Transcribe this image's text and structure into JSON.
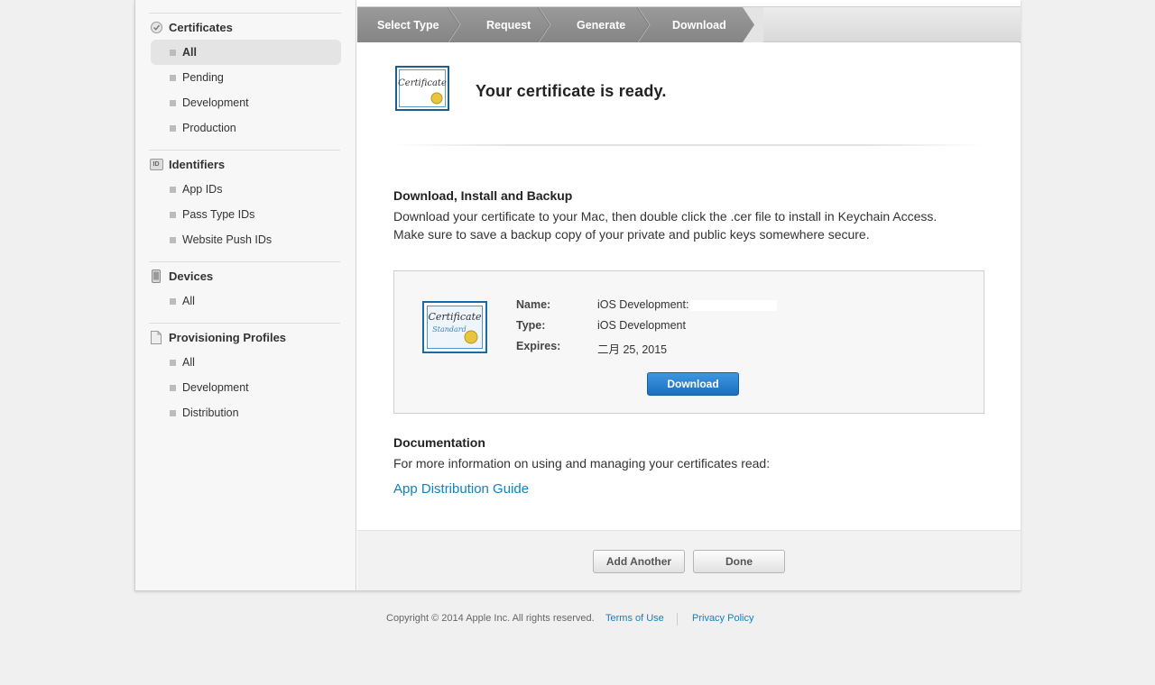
{
  "sidebar": {
    "sections": [
      {
        "title": "Certificates",
        "icon": "certificate-seal-icon",
        "items": [
          "All",
          "Pending",
          "Development",
          "Production"
        ],
        "active": "All"
      },
      {
        "title": "Identifiers",
        "icon": "id-badge-icon",
        "icon_text": "ID",
        "items": [
          "App IDs",
          "Pass Type IDs",
          "Website Push IDs"
        ]
      },
      {
        "title": "Devices",
        "icon": "iphone-icon",
        "items": [
          "All"
        ]
      },
      {
        "title": "Provisioning Profiles",
        "icon": "document-icon",
        "items": [
          "All",
          "Development",
          "Distribution"
        ]
      }
    ]
  },
  "steps": [
    "Select Type",
    "Request",
    "Generate",
    "Download"
  ],
  "current_step": "Download",
  "hero": {
    "title": "Your certificate is ready."
  },
  "download_section": {
    "heading": "Download, Install and Backup",
    "text": "Download your certificate to your Mac, then double click the .cer file to install in Keychain Access. Make sure to save a backup copy of your private and public keys somewhere secure."
  },
  "certificate": {
    "name_label": "Name:",
    "name_value": "iOS Development:",
    "type_label": "Type:",
    "type_value": "iOS Development",
    "expires_label": "Expires:",
    "expires_value": "二月 25, 2015",
    "download_button": "Download",
    "icon_text_1": "Certificate",
    "icon_text_2": "Standard"
  },
  "documentation": {
    "heading": "Documentation",
    "text": "For more information on using and managing your certificates read:",
    "link": "App Distribution Guide"
  },
  "actions": {
    "add_another": "Add Another",
    "done": "Done"
  },
  "footer": {
    "copyright": "Copyright © 2014 Apple Inc. All rights reserved.",
    "terms": "Terms of Use",
    "privacy": "Privacy Policy"
  },
  "colors": {
    "link": "#0a84c6",
    "primary_button": "#1a6fc0",
    "step_active": "#858585"
  }
}
